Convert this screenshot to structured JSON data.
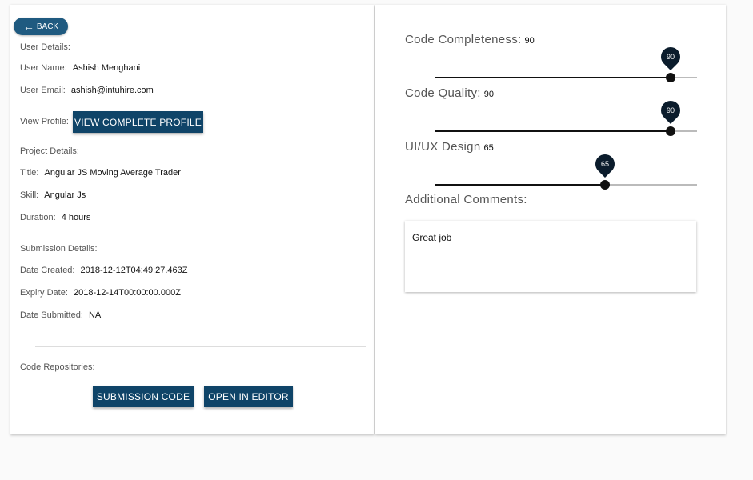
{
  "back_label": "BACK",
  "user": {
    "section_title": "User Details:",
    "name_label": "User Name:",
    "name_value": "Ashish Menghani",
    "email_label": "User Email:",
    "email_value": "ashish@intuhire.com",
    "profile_label": "View Profile:",
    "profile_button": "VIEW COMPLETE PROFILE"
  },
  "project": {
    "section_title": "Project Details:",
    "title_label": "Title:",
    "title_value": "Angular JS Moving Average Trader",
    "skill_label": "Skill:",
    "skill_value": "Angular Js",
    "duration_label": "Duration:",
    "duration_value": "4 hours"
  },
  "submission": {
    "section_title": "Submission Details:",
    "created_label": "Date Created:",
    "created_value": "2018-12-12T04:49:27.463Z",
    "expiry_label": "Expiry Date:",
    "expiry_value": "2018-12-14T00:00:00.000Z",
    "submitted_label": "Date Submitted:",
    "submitted_value": "NA"
  },
  "repos": {
    "section_title": "Code Repositories:",
    "submission_button": "SUBMISSION CODE",
    "editor_button": "OPEN IN EDITOR"
  },
  "scores": [
    {
      "label": "Code Completeness:",
      "value": 90
    },
    {
      "label": "Code Quality:",
      "value": 90
    },
    {
      "label": "UI/UX Design",
      "value": 65
    }
  ],
  "comments": {
    "label": "Additional Comments:",
    "value": "Great job"
  },
  "colors": {
    "button_bg": "#0f4468",
    "back_bg": "#1f5a80",
    "slider": "#111111",
    "pin": "#0b1c2c"
  }
}
